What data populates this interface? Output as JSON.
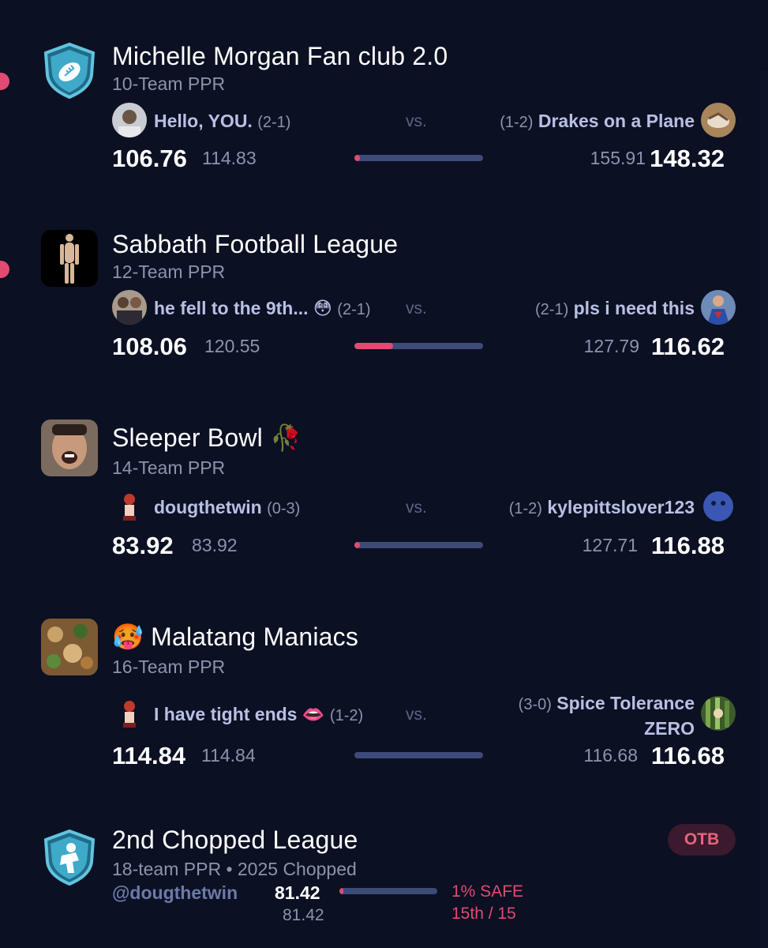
{
  "leagues": [
    {
      "title": "Michelle Morgan Fan club 2.0",
      "subtitle": "10-Team PPR",
      "home": {
        "name": "Hello, YOU.",
        "record": "(2-1)",
        "score": "106.76",
        "projected": "114.83"
      },
      "away": {
        "name": "Drakes on a Plane",
        "record": "(1-2)",
        "score": "148.32",
        "projected": "155.91"
      },
      "vs": "vs.",
      "win_prob": 0.02
    },
    {
      "title": "Sabbath Football League",
      "subtitle": "12-Team PPR",
      "home": {
        "name": "he fell to the 9th... 😳",
        "record": "(2-1)",
        "score": "108.06",
        "projected": "120.55"
      },
      "away": {
        "name": "pls i need this",
        "record": "(2-1)",
        "score": "116.62",
        "projected": "127.79"
      },
      "vs": "vs.",
      "win_prob": 0.3
    },
    {
      "title": "Sleeper Bowl 🥀",
      "subtitle": "14-Team PPR",
      "home": {
        "name": "dougthetwin",
        "record": "(0-3)",
        "score": "83.92",
        "projected": "83.92"
      },
      "away": {
        "name": "kylepittslover123",
        "record": "(1-2)",
        "score": "116.88",
        "projected": "127.71"
      },
      "vs": "vs.",
      "win_prob": 0.02
    },
    {
      "title": "🥵 Malatang Maniacs",
      "subtitle": "16-Team PPR",
      "home": {
        "name": "I have tight ends 👄",
        "record": "(1-2)",
        "score": "114.84",
        "projected": "114.84"
      },
      "away": {
        "name_line1": "Spice Tolerance",
        "name_line2": "ZERO",
        "record": "(3-0)",
        "score": "116.68",
        "projected": "116.68"
      },
      "vs": "vs.",
      "win_prob": 0.0
    }
  ],
  "chopped": {
    "title": "2nd Chopped League",
    "subtitle": "18-team PPR • 2025 Chopped",
    "badge": "OTB",
    "user": "@dougthetwin",
    "score": "81.42",
    "projected": "81.42",
    "safe": "1% SAFE",
    "rank": "15th / 15",
    "safe_prob": 0.01
  },
  "colors": {
    "background": "#0b1023",
    "accent": "#e24a72",
    "bar_track": "#3e4a78",
    "team_name": "#b9c0e3",
    "muted": "#8d93ad"
  }
}
